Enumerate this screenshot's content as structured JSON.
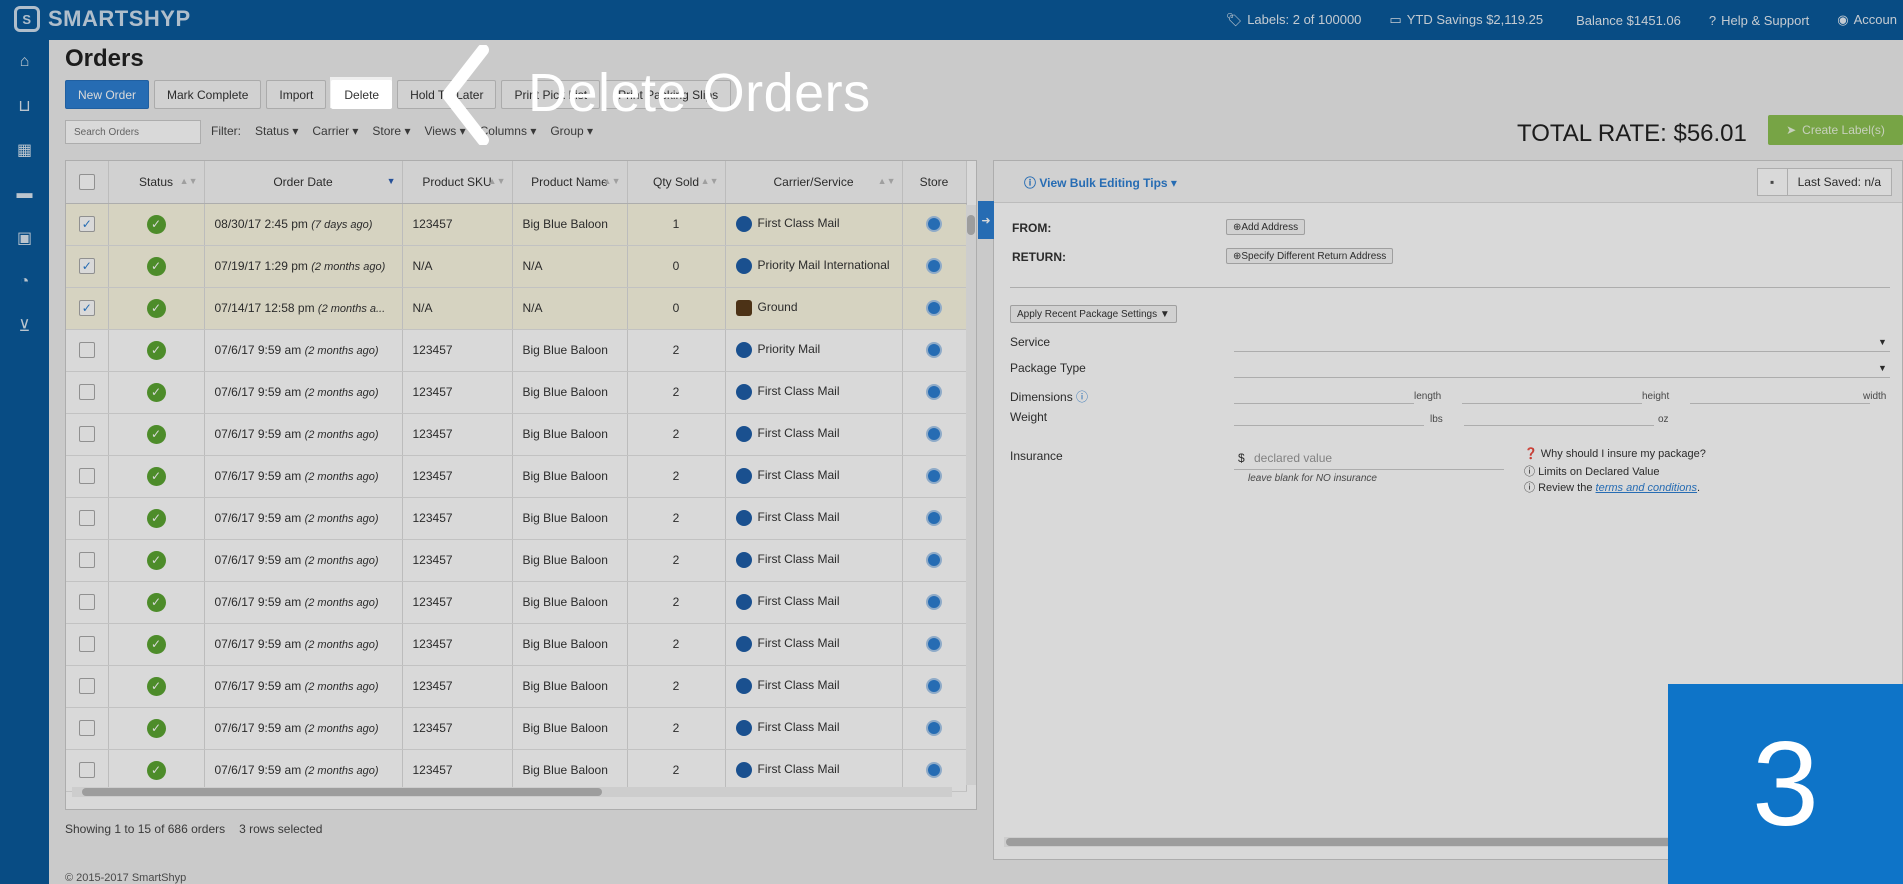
{
  "app": {
    "brand": "SMARTSHYP"
  },
  "topbar": {
    "labels": "Labels: 2 of 100000",
    "ytd": "YTD Savings $2,119.25",
    "balance": "Balance $1451.06",
    "help": "Help & Support",
    "account": "Accoun"
  },
  "sidebar": {
    "items": [
      "home-icon",
      "basket-icon",
      "calendar-icon",
      "truck-icon",
      "contacts-icon",
      "pie-chart-icon",
      "cart-icon"
    ]
  },
  "page": {
    "title": "Orders"
  },
  "toolbar": {
    "new_order": "New Order",
    "mark_complete": "Mark Complete",
    "import": "Import",
    "delete": "Delete",
    "hold": "Hold Till Later",
    "print_pick": "Print Pick List",
    "print_packing": "Print Packing Slips"
  },
  "search": {
    "placeholder": "Search Orders"
  },
  "filters": {
    "label": "Filter:",
    "status": "Status",
    "carrier": "Carrier",
    "store": "Store",
    "views": "Views",
    "columns": "Columns",
    "group": "Group"
  },
  "total_rate": "TOTAL RATE: $56.01",
  "create_label": "Create Label(s)",
  "table": {
    "headers": [
      "Status",
      "Order Date",
      "Product SKU",
      "Product Name",
      "Qty Sold",
      "Carrier/Service",
      "Store"
    ],
    "rows": [
      {
        "checked": true,
        "date": "08/30/17 2:45 pm",
        "ago": "(7 days ago)",
        "sku": "123457",
        "name": "Big Blue Baloon",
        "qty": "1",
        "carrier": "First Class Mail",
        "carrier_icon": "usps"
      },
      {
        "checked": true,
        "date": "07/19/17 1:29 pm",
        "ago": "(2 months ago)",
        "sku": "N/A",
        "name": "N/A",
        "qty": "0",
        "carrier": "Priority Mail International",
        "carrier_icon": "usps"
      },
      {
        "checked": true,
        "date": "07/14/17 12:58 pm",
        "ago": "(2 months a...",
        "sku": "N/A",
        "name": "N/A",
        "qty": "0",
        "carrier": "Ground",
        "carrier_icon": "ups"
      },
      {
        "checked": false,
        "date": "07/6/17 9:59 am",
        "ago": "(2 months ago)",
        "sku": "123457",
        "name": "Big Blue Baloon",
        "qty": "2",
        "carrier": "Priority Mail",
        "carrier_icon": "usps"
      },
      {
        "checked": false,
        "date": "07/6/17 9:59 am",
        "ago": "(2 months ago)",
        "sku": "123457",
        "name": "Big Blue Baloon",
        "qty": "2",
        "carrier": "First Class Mail",
        "carrier_icon": "usps"
      },
      {
        "checked": false,
        "date": "07/6/17 9:59 am",
        "ago": "(2 months ago)",
        "sku": "123457",
        "name": "Big Blue Baloon",
        "qty": "2",
        "carrier": "First Class Mail",
        "carrier_icon": "usps"
      },
      {
        "checked": false,
        "date": "07/6/17 9:59 am",
        "ago": "(2 months ago)",
        "sku": "123457",
        "name": "Big Blue Baloon",
        "qty": "2",
        "carrier": "First Class Mail",
        "carrier_icon": "usps"
      },
      {
        "checked": false,
        "date": "07/6/17 9:59 am",
        "ago": "(2 months ago)",
        "sku": "123457",
        "name": "Big Blue Baloon",
        "qty": "2",
        "carrier": "First Class Mail",
        "carrier_icon": "usps"
      },
      {
        "checked": false,
        "date": "07/6/17 9:59 am",
        "ago": "(2 months ago)",
        "sku": "123457",
        "name": "Big Blue Baloon",
        "qty": "2",
        "carrier": "First Class Mail",
        "carrier_icon": "usps"
      },
      {
        "checked": false,
        "date": "07/6/17 9:59 am",
        "ago": "(2 months ago)",
        "sku": "123457",
        "name": "Big Blue Baloon",
        "qty": "2",
        "carrier": "First Class Mail",
        "carrier_icon": "usps"
      },
      {
        "checked": false,
        "date": "07/6/17 9:59 am",
        "ago": "(2 months ago)",
        "sku": "123457",
        "name": "Big Blue Baloon",
        "qty": "2",
        "carrier": "First Class Mail",
        "carrier_icon": "usps"
      },
      {
        "checked": false,
        "date": "07/6/17 9:59 am",
        "ago": "(2 months ago)",
        "sku": "123457",
        "name": "Big Blue Baloon",
        "qty": "2",
        "carrier": "First Class Mail",
        "carrier_icon": "usps"
      },
      {
        "checked": false,
        "date": "07/6/17 9:59 am",
        "ago": "(2 months ago)",
        "sku": "123457",
        "name": "Big Blue Baloon",
        "qty": "2",
        "carrier": "First Class Mail",
        "carrier_icon": "usps"
      },
      {
        "checked": false,
        "date": "07/6/17 9:59 am",
        "ago": "(2 months ago)",
        "sku": "123457",
        "name": "Big Blue Baloon",
        "qty": "2",
        "carrier": "First Class Mail",
        "carrier_icon": "usps"
      }
    ]
  },
  "status_bar": {
    "showing": "Showing 1 to 15 of 686 orders",
    "selected": "3 rows selected"
  },
  "footer": {
    "copyright": "© 2015-2017 SmartShyp"
  },
  "panel": {
    "bulk_tips": "View Bulk Editing Tips",
    "last_saved": "Last Saved: n/a",
    "from": "FROM:",
    "return": "RETURN:",
    "add_address": "Add Address",
    "specify_return": "Specify Different Return Address",
    "apply_recent": "Apply Recent Package Settings",
    "service": "Service",
    "package_type": "Package Type",
    "dimensions": "Dimensions",
    "weight": "Weight",
    "insurance": "Insurance",
    "length": "length",
    "height": "height",
    "width": "width",
    "lbs": "lbs",
    "oz": "oz",
    "currency": "$",
    "declared_placeholder": "declared value",
    "declared_hint": "leave blank for NO insurance",
    "why_insure": "Why should I insure my package?",
    "limits": "Limits on Declared Value",
    "review_prefix": "Review the",
    "terms": "terms and conditions",
    "review_suffix": "."
  },
  "annotation": {
    "callout": "Delete Orders",
    "step": "3"
  }
}
